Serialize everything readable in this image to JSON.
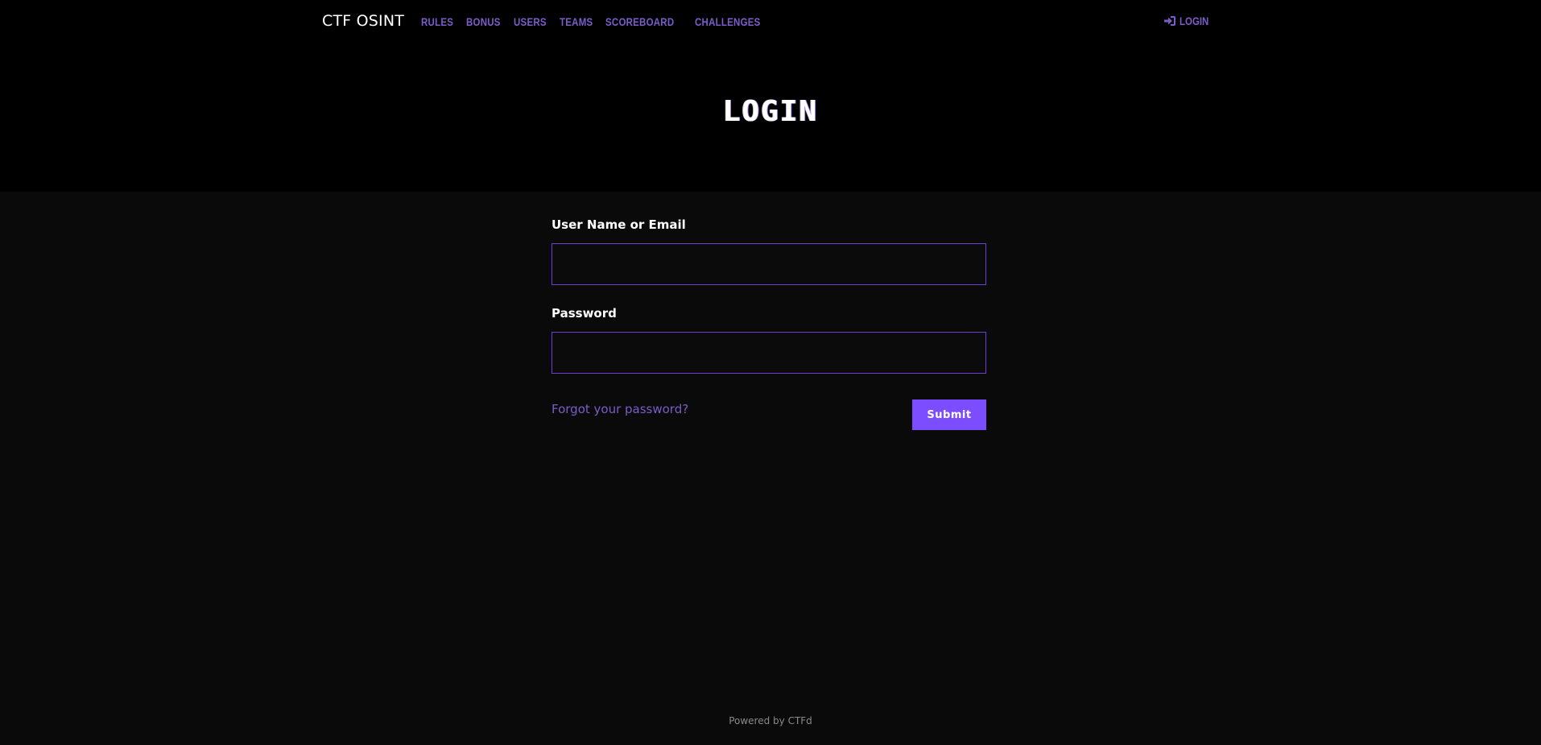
{
  "navbar": {
    "brand": "CTF OSINT",
    "links": [
      {
        "label": "RULES"
      },
      {
        "label": "BONUS"
      },
      {
        "label": "USERS"
      },
      {
        "label": "TEAMS"
      },
      {
        "label": "SCOREBOARD"
      },
      {
        "label": "CHALLENGES"
      }
    ],
    "login": {
      "label": "LOGIN",
      "icon": "sign-in-icon"
    }
  },
  "header": {
    "title": "LOGIN"
  },
  "form": {
    "username_label": "User Name or Email",
    "username_value": "",
    "password_label": "Password",
    "password_value": "",
    "forgot_label": "Forgot your password?",
    "submit_label": "Submit"
  },
  "footer": {
    "text": "Powered by CTFd"
  },
  "colors": {
    "accent": "#7c4dff",
    "link": "#7b5cc9",
    "background": "#0a0a0a",
    "header_background": "#000000"
  }
}
